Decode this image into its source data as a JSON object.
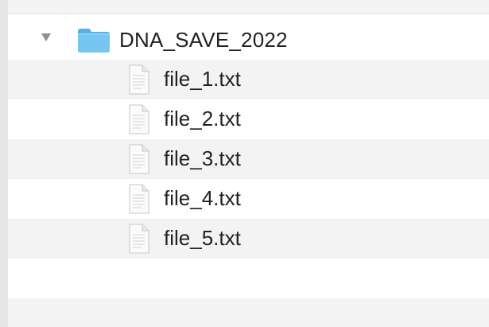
{
  "folder": {
    "name": "DNA_SAVE_2022",
    "icon": "folder-icon",
    "expanded": true,
    "color": "#5fb8ec"
  },
  "files": [
    {
      "name": "file_1.txt",
      "icon": "text-file-icon"
    },
    {
      "name": "file_2.txt",
      "icon": "text-file-icon"
    },
    {
      "name": "file_3.txt",
      "icon": "text-file-icon"
    },
    {
      "name": "file_4.txt",
      "icon": "text-file-icon"
    },
    {
      "name": "file_5.txt",
      "icon": "text-file-icon"
    }
  ]
}
